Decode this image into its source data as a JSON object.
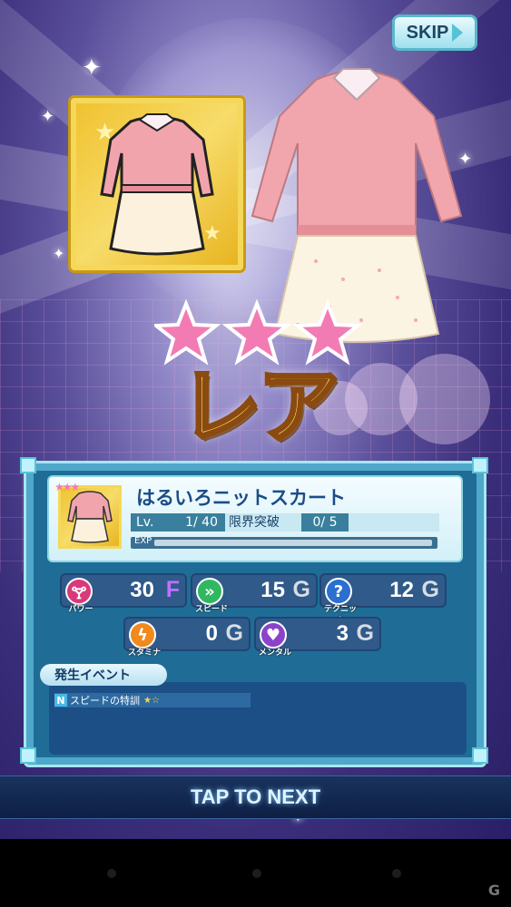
{
  "header": {
    "skip_label": "SKIP"
  },
  "rarity": {
    "stars": 3,
    "label": "レア"
  },
  "item": {
    "name": "はるいろニットスカート",
    "level_label": "Lv.",
    "level_value": "1/ 40",
    "limit_label": "限界突破",
    "limit_value": "0/ 5",
    "exp_label": "EXP",
    "exp_progress": 1.0
  },
  "stats": [
    {
      "key": "power",
      "label": "パワー",
      "icon": "power-icon",
      "value": "30",
      "grade": "F",
      "color": "#d9387a",
      "grade_color": "#c070ff"
    },
    {
      "key": "speed",
      "label": "スピード",
      "icon": "speed-icon",
      "value": "15",
      "grade": "G",
      "color": "#30b860",
      "grade_color": "#d8dde2"
    },
    {
      "key": "technique",
      "label": "テクニック",
      "icon": "technique-icon",
      "value": "12",
      "grade": "G",
      "color": "#2b6fd0",
      "grade_color": "#d8dde2"
    },
    {
      "key": "stamina",
      "label": "スタミナ",
      "icon": "stamina-icon",
      "value": "0",
      "grade": "G",
      "color": "#f08a1c",
      "grade_color": "#d8dde2"
    },
    {
      "key": "mental",
      "label": "メンタル",
      "icon": "mental-icon",
      "value": "3",
      "grade": "G",
      "color": "#8a44c8",
      "grade_color": "#d8dde2"
    }
  ],
  "events": {
    "heading": "発生イベント",
    "items": [
      {
        "tag": "N",
        "label": "スピードの特訓",
        "stars": "★☆"
      }
    ]
  },
  "footer": {
    "tap_label": "TAP TO NEXT"
  },
  "watermark": "G"
}
